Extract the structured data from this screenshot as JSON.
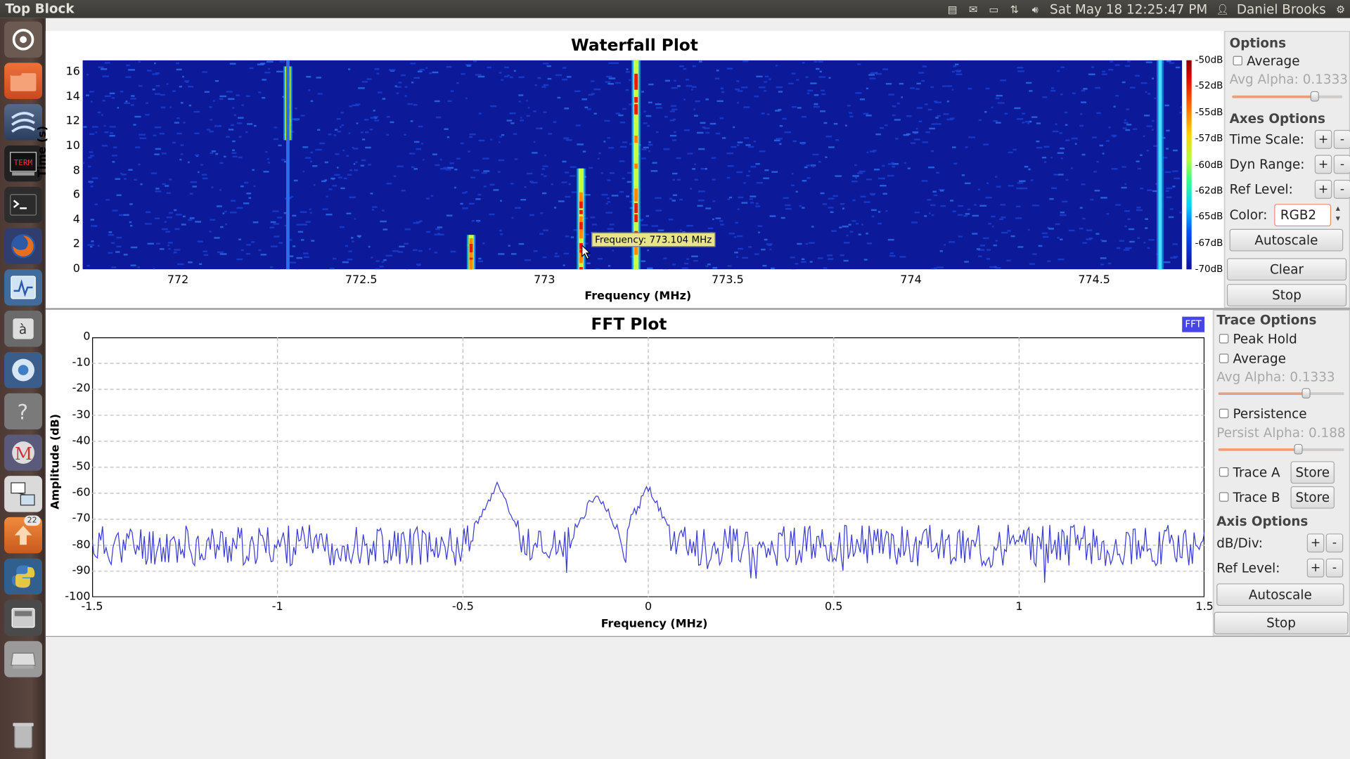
{
  "window": {
    "title": "Top Block"
  },
  "topbar": {
    "clock": "Sat May 18 12:25:47 PM",
    "user": "Daniel Brooks"
  },
  "launcher": {
    "badge_count": "22"
  },
  "waterfall": {
    "title": "Waterfall Plot",
    "xlabel": "Frequency (MHz)",
    "ylabel": "Time (s)",
    "x_ticks": [
      "772",
      "772.5",
      "773",
      "773.5",
      "774",
      "774.5"
    ],
    "y_ticks": [
      "0",
      "2",
      "4",
      "6",
      "8",
      "10",
      "12",
      "14",
      "16"
    ],
    "colorbar_ticks": [
      "-50dB",
      "-52dB",
      "-55dB",
      "-57dB",
      "-60dB",
      "-62dB",
      "-65dB",
      "-67dB",
      "-70dB"
    ],
    "tooltip": "Frequency: 773.104 MHz"
  },
  "fft": {
    "title": "FFT Plot",
    "legend": "FFT",
    "xlabel": "Frequency (MHz)",
    "ylabel": "Amplitude (dB)",
    "x_ticks": [
      "-1.5",
      "-1",
      "-0.5",
      "0",
      "0.5",
      "1",
      "1.5"
    ],
    "y_ticks": [
      "0",
      "-10",
      "-20",
      "-30",
      "-40",
      "-50",
      "-60",
      "-70",
      "-80",
      "-90",
      "-100"
    ],
    "trace_color": "#3a3ad6"
  },
  "waterfall_panel": {
    "options_title": "Options",
    "average_label": "Average",
    "avg_alpha_label": "Avg Alpha: 0.1333",
    "avg_alpha_value": 0.75,
    "axes_title": "Axes Options",
    "time_scale_label": "Time Scale:",
    "dyn_range_label": "Dyn Range:",
    "ref_level_label": "Ref Level:",
    "color_label": "Color:",
    "color_value": "RGB2",
    "plus": "+",
    "minus": "-",
    "autoscale_label": "Autoscale",
    "clear_label": "Clear",
    "stop_label": "Stop"
  },
  "fft_panel": {
    "trace_title": "Trace Options",
    "peak_hold_label": "Peak Hold",
    "average_label": "Average",
    "avg_alpha_label": "Avg Alpha: 0.1333",
    "avg_alpha_value": 0.7,
    "persistence_label": "Persistence",
    "persist_alpha_label": "Persist Alpha: 0.188",
    "persist_alpha_value": 0.64,
    "trace_a_label": "Trace A",
    "trace_b_label": "Trace B",
    "store_label": "Store",
    "axis_title": "Axis Options",
    "db_div_label": "dB/Div:",
    "ref_level_label": "Ref Level:",
    "plus": "+",
    "minus": "-",
    "autoscale_label": "Autoscale",
    "stop_label": "Stop"
  },
  "chart_data": [
    {
      "type": "heatmap",
      "title": "Waterfall Plot",
      "xlabel": "Frequency (MHz)",
      "ylabel": "Time (s)",
      "xlim": [
        771.74,
        774.74
      ],
      "ylim": [
        0,
        17
      ],
      "colorbar": [
        "-50dB",
        "-70dB"
      ],
      "signals": [
        {
          "freq_mhz": 772.3,
          "time_start": 10.5,
          "time_end": 16.5,
          "level": "high"
        },
        {
          "freq_mhz": 772.3,
          "time_start": 0,
          "time_end": 17,
          "level": "low"
        },
        {
          "freq_mhz": 772.8,
          "time_start": 0,
          "time_end": 2.8,
          "level": "high"
        },
        {
          "freq_mhz": 773.1,
          "time_start": 0,
          "time_end": 8.2,
          "level": "high"
        },
        {
          "freq_mhz": 773.25,
          "time_start": 0,
          "time_end": 17,
          "level": "high"
        },
        {
          "freq_mhz": 774.68,
          "time_start": 0,
          "time_end": 17,
          "level": "medium"
        }
      ]
    },
    {
      "type": "line",
      "title": "FFT Plot",
      "xlabel": "Frequency (MHz)",
      "ylabel": "Amplitude (dB)",
      "xlim": [
        -1.5,
        1.5
      ],
      "ylim": [
        -100,
        0
      ],
      "series": [
        {
          "name": "FFT",
          "noise_floor_db": -80,
          "peaks": [
            {
              "x": -0.41,
              "y": -57
            },
            {
              "x": -0.14,
              "y": -59
            },
            {
              "x": 0.0,
              "y": -58
            }
          ]
        }
      ]
    }
  ]
}
